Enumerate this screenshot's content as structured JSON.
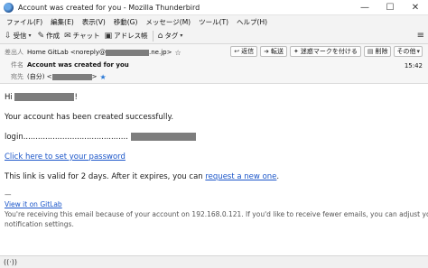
{
  "window": {
    "title": "Account was created for you - Mozilla Thunderbird",
    "controls": [
      "—",
      "☐",
      "✕"
    ]
  },
  "menubar": [
    "ファイル(F)",
    "編集(E)",
    "表示(V)",
    "移動(G)",
    "メッセージ(M)",
    "ツール(T)",
    "ヘルプ(H)"
  ],
  "toolbar": {
    "get_mail": "受信",
    "write": "作成",
    "chat": "チャット",
    "address_book": "アドレス帳",
    "tag": "タグ"
  },
  "header": {
    "from_label": "差出人",
    "from_name": "Home GitLab <noreply@",
    "from_domain": ".ne.jp>",
    "subject_label": "件名",
    "subject": "Account was created for you",
    "to_label": "宛先",
    "to_prefix": "(自分) <",
    "to_suffix": ">",
    "time": "15:42",
    "actions": {
      "reply": "返信",
      "forward": "転送",
      "junk": "迷惑マークを付ける",
      "delete": "削除",
      "more": "その他"
    }
  },
  "email": {
    "greeting_prefix": "Hi",
    "greeting_suffix": "!",
    "line1": "Your account has been created successfully.",
    "login_label": "login...........................................",
    "password_link": "Click here to set your password",
    "validity_text": "This link is valid for 2 days. After it expires, you can",
    "new_one_link": "request a new one",
    "validity_end": ".",
    "separator": "—",
    "gitlab_link": "View it on GitLab",
    "footer_line1": "You're receiving this email because of your account on 192.168.0.121. If you'd like to receive fewer emails, you can adjust your",
    "footer_line2": "notification settings."
  },
  "status": {
    "icon": "wifi-icon"
  }
}
